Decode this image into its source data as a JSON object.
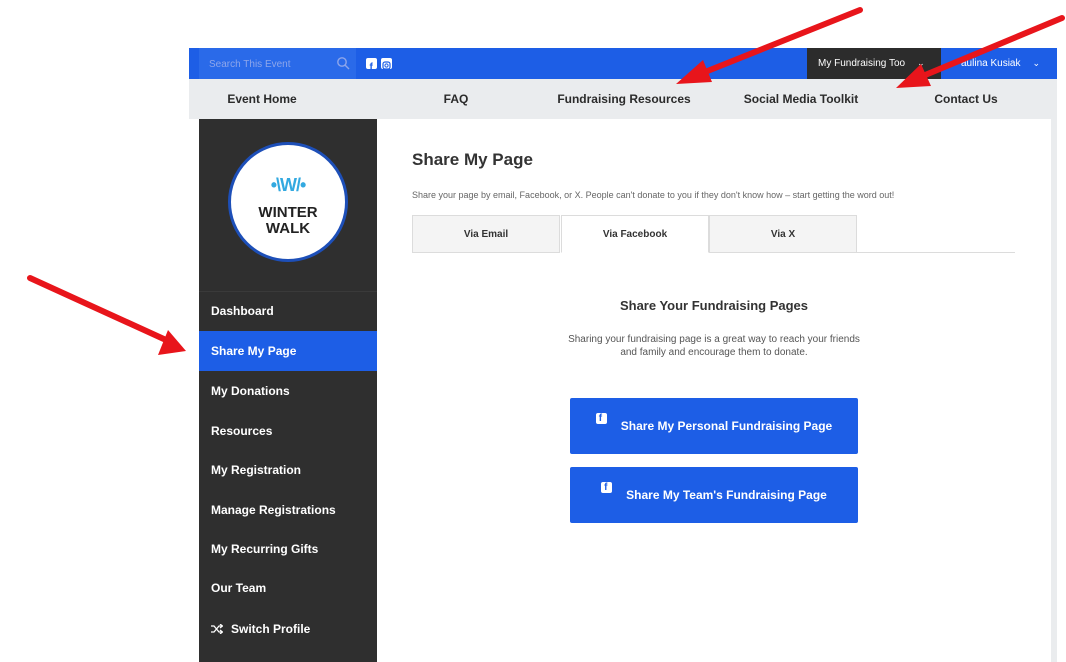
{
  "topbar": {
    "search": {
      "placeholder": "Search This Event",
      "icon": "search-icon"
    },
    "social_icons": [
      "facebook-icon",
      "instagram-icon"
    ],
    "fundraising_tools_label": "My Fundraising Too",
    "user_name": "aulina Kusiak"
  },
  "nav": {
    "items": [
      "Event Home",
      "FAQ",
      "Fundraising Resources",
      "Social Media Toolkit",
      "Contact Us"
    ]
  },
  "logo": {
    "line1": "WINTER",
    "line2": "WALK",
    "mark": "•\\W/•"
  },
  "sidebar": {
    "items": [
      {
        "label": "Dashboard"
      },
      {
        "label": "Share My Page",
        "active": true
      },
      {
        "label": "My Donations"
      },
      {
        "label": "Resources"
      },
      {
        "label": "My Registration"
      },
      {
        "label": "Manage Registrations"
      },
      {
        "label": "My Recurring Gifts"
      },
      {
        "label": "Our Team"
      },
      {
        "label": "Switch Profile",
        "icon": "shuffle-icon"
      }
    ]
  },
  "main": {
    "title": "Share My Page",
    "description": "Share your page by email, Facebook, or X. People can't donate to you if they don't know how – start getting the word out!",
    "tabs": [
      {
        "label": "Via Email"
      },
      {
        "label": "Via Facebook",
        "active": true
      },
      {
        "label": "Via X"
      }
    ],
    "section_title": "Share Your Fundraising Pages",
    "section_body": "Sharing your fundraising page is a great way to reach your friends and family and encourage them to donate.",
    "buttons": [
      {
        "label": "Share My Personal Fundraising Page",
        "icon": "facebook-icon"
      },
      {
        "label": "Share My Team's Fundraising Page",
        "icon": "facebook-icon"
      }
    ]
  },
  "colors": {
    "brand_blue": "#1d5ee6",
    "sidebar_dark": "#2f2f2f",
    "annotation_red": "#e8151b"
  }
}
